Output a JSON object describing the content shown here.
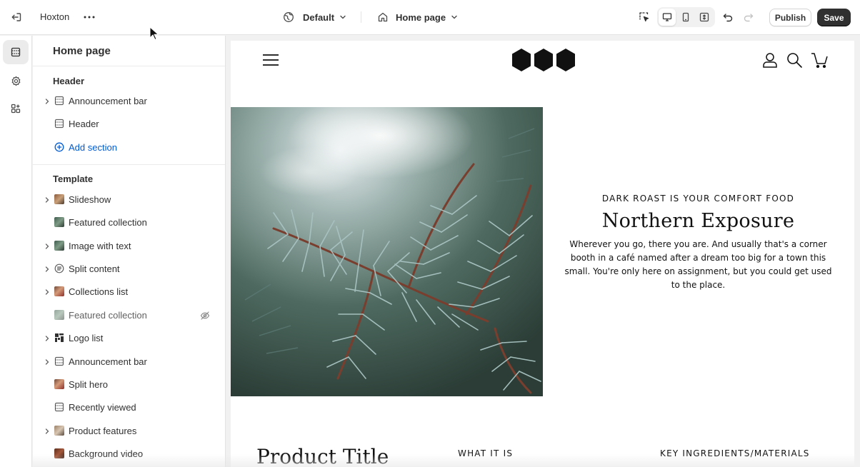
{
  "topbar": {
    "store_name": "Hoxton",
    "theme_selector": "Default",
    "page_selector": "Home page",
    "publish_label": "Publish",
    "save_label": "Save"
  },
  "rail": {
    "items": [
      {
        "icon": "sections-icon",
        "active": true
      },
      {
        "icon": "settings-gear-icon",
        "active": false
      },
      {
        "icon": "apps-icon",
        "active": false
      }
    ]
  },
  "panel": {
    "title": "Home page",
    "header_group": {
      "label": "Header",
      "items": [
        {
          "label": "Announcement bar",
          "icon": "section-layout-icon",
          "expandable": true
        },
        {
          "label": "Header",
          "icon": "section-layout-icon",
          "expandable": false
        }
      ],
      "add_label": "Add section"
    },
    "template_group": {
      "label": "Template",
      "items": [
        {
          "label": "Slideshow",
          "icon": "slideshow-thumb",
          "expandable": true
        },
        {
          "label": "Featured collection",
          "icon": "collection-thumb",
          "expandable": false
        },
        {
          "label": "Image with text",
          "icon": "image-text-thumb",
          "expandable": true
        },
        {
          "label": "Split content",
          "icon": "text-block-icon",
          "expandable": true
        },
        {
          "label": "Collections list",
          "icon": "collections-thumb",
          "expandable": true
        },
        {
          "label": "Featured collection",
          "icon": "collection-thumb",
          "expandable": false,
          "hidden": true
        },
        {
          "label": "Logo list",
          "icon": "logo-thumb",
          "expandable": true
        },
        {
          "label": "Announcement bar",
          "icon": "section-layout-icon",
          "expandable": true
        },
        {
          "label": "Split hero",
          "icon": "split-hero-thumb",
          "expandable": false
        },
        {
          "label": "Recently viewed",
          "icon": "section-layout-icon",
          "expandable": false
        },
        {
          "label": "Product features",
          "icon": "product-features-thumb",
          "expandable": true
        },
        {
          "label": "Background video",
          "icon": "video-thumb",
          "expandable": false
        }
      ]
    }
  },
  "preview": {
    "eyebrow": "DARK ROAST IS YOUR COMFORT FOOD",
    "heading": "Northern Exposure",
    "body": "Wherever you go, there you are. And usually that's a corner booth in a café named after a dream too big for a town this small. You're only here on assignment, but you could get used to the place.",
    "product_title": "Product Title",
    "column_1": "WHAT IT IS",
    "column_2": "KEY INGREDIENTS/MATERIALS"
  },
  "colors": {
    "accent_link": "#005bd3",
    "save_button": "#303030",
    "text": "#303030"
  }
}
